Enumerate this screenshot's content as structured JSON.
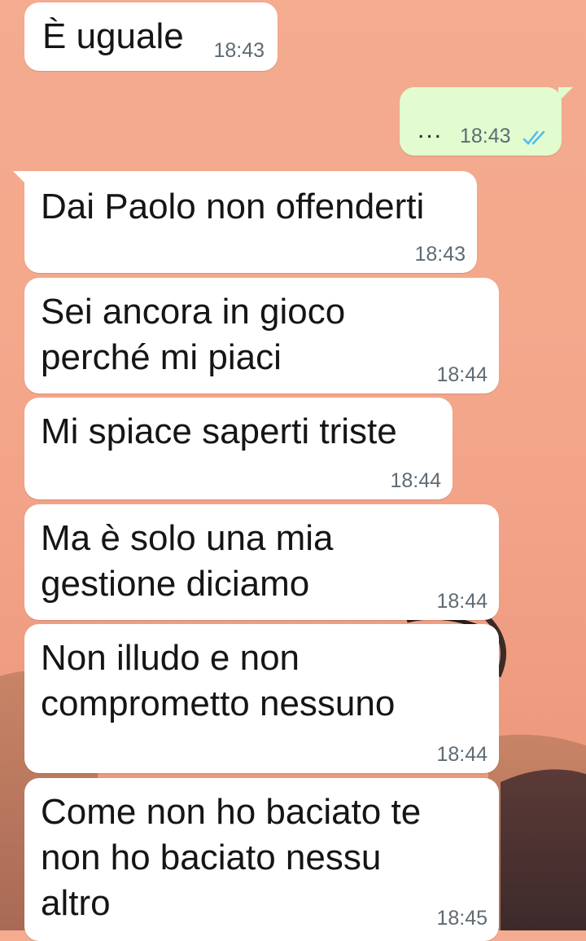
{
  "messages": [
    {
      "direction": "incoming",
      "text": "È uguale",
      "time": "18:43"
    },
    {
      "direction": "outgoing",
      "text": "...",
      "time": "18:43",
      "status_icon": "double-check-read-icon",
      "status_color": "#53bdeb"
    },
    {
      "direction": "incoming",
      "text": "Dai Paolo non offenderti",
      "time": "18:43"
    },
    {
      "direction": "incoming",
      "text": "Sei ancora in gioco\nperché mi piaci",
      "time": "18:44"
    },
    {
      "direction": "incoming",
      "text": "Mi spiace saperti triste",
      "time": "18:44"
    },
    {
      "direction": "incoming",
      "text": "Ma è solo una mia\ngestione diciamo",
      "time": "18:44"
    },
    {
      "direction": "incoming",
      "text": "Non illudo e non\ncomprometto nessuno",
      "time": "18:44"
    },
    {
      "direction": "incoming",
      "text": "Come non ho baciato te\nnon ho baciato nessu\naltro",
      "time": "18:45"
    }
  ],
  "colors": {
    "incoming_bubble": "#ffffff",
    "outgoing_bubble": "#e2fbcf",
    "wallpaper_sky": "#f4a88c",
    "timestamp": "#5f6b73"
  }
}
